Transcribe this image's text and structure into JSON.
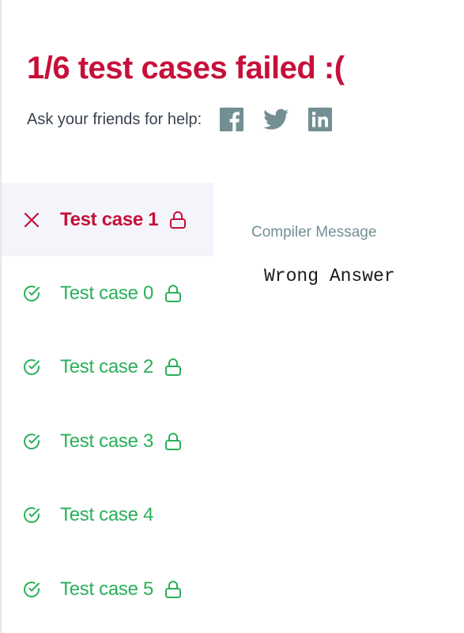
{
  "summary": {
    "headline": "1/6 test cases failed :(",
    "help_text": "Ask your friends for help:"
  },
  "social": [
    {
      "name": "facebook",
      "icon": "facebook-icon"
    },
    {
      "name": "twitter",
      "icon": "twitter-icon"
    },
    {
      "name": "linkedin",
      "icon": "linkedin-icon"
    }
  ],
  "tests": [
    {
      "label": "Test case 1",
      "status": "failed",
      "locked": true,
      "active": true
    },
    {
      "label": "Test case 0",
      "status": "passed",
      "locked": true,
      "active": false
    },
    {
      "label": "Test case 2",
      "status": "passed",
      "locked": true,
      "active": false
    },
    {
      "label": "Test case 3",
      "status": "passed",
      "locked": true,
      "active": false
    },
    {
      "label": "Test case 4",
      "status": "passed",
      "locked": false,
      "active": false
    },
    {
      "label": "Test case 5",
      "status": "passed",
      "locked": true,
      "active": false
    }
  ],
  "compiler": {
    "title": "Compiler Message",
    "output": "Wrong Answer"
  },
  "colors": {
    "failed": "#c6103a",
    "passed": "#2ab05a",
    "social_icon": "#738f93",
    "active_bg": "#f3f5fa"
  }
}
